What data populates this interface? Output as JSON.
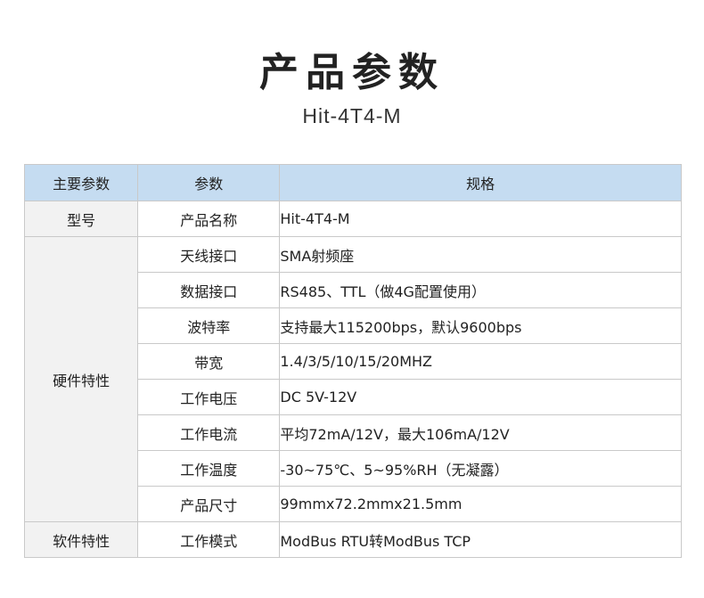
{
  "title": "产品参数",
  "subtitle": "Hit-4T4-M",
  "table": {
    "headers": [
      "主要参数",
      "参数",
      "规格"
    ],
    "groups": [
      {
        "name": "型号",
        "rows": [
          {
            "param": "产品名称",
            "value": "Hit-4T4-M"
          }
        ]
      },
      {
        "name": "硬件特性",
        "rows": [
          {
            "param": "天线接口",
            "value": "SMA射频座"
          },
          {
            "param": "数据接口",
            "value": "RS485、TTL（做4G配置使用）"
          },
          {
            "param": "波特率",
            "value": "支持最大115200bps，默认9600bps"
          },
          {
            "param": "带宽",
            "value": "1.4/3/5/10/15/20MHZ"
          },
          {
            "param": "工作电压",
            "value": "DC 5V-12V"
          },
          {
            "param": "工作电流",
            "value": "平均72mA/12V，最大106mA/12V"
          },
          {
            "param": "工作温度",
            "value": " -30~75℃、5~95%RH（无凝露）"
          },
          {
            "param": "产品尺寸",
            "value": "99mmx72.2mmx21.5mm"
          }
        ]
      },
      {
        "name": "软件特性",
        "rows": [
          {
            "param": "工作模式",
            "value": "ModBus RTU转ModBus TCP"
          }
        ]
      }
    ]
  },
  "colors": {
    "header_bg": "#c5dcf1",
    "group_bg": "#f2f2f2",
    "border": "#c9c9c9"
  }
}
